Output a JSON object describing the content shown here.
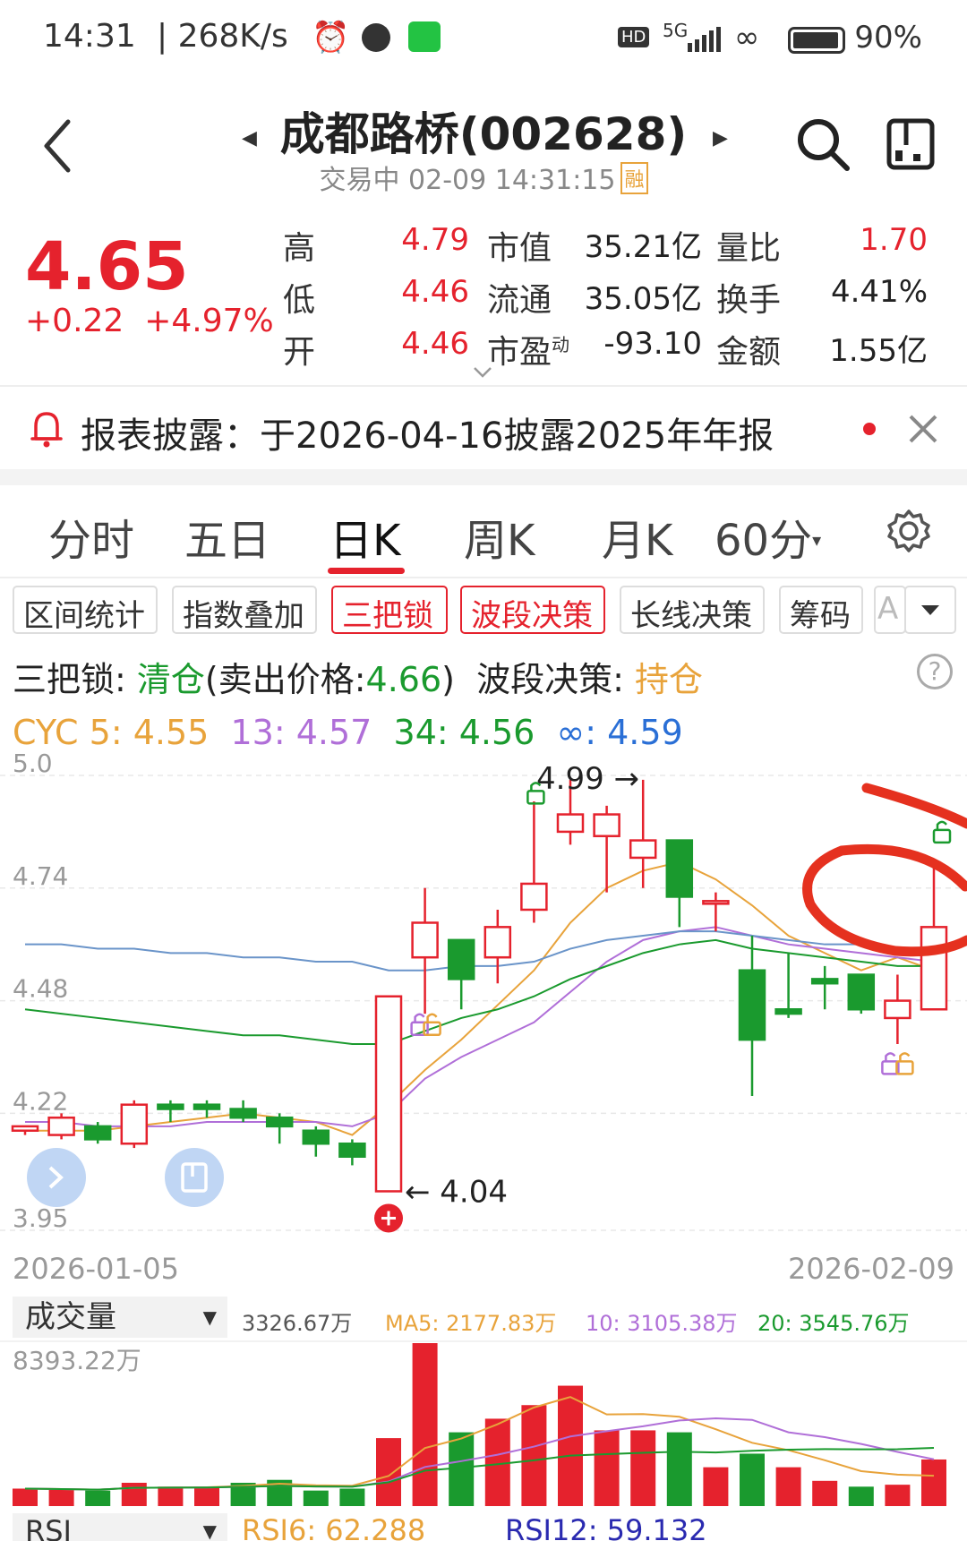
{
  "status": {
    "time": "14:31",
    "speed": "268K/s",
    "network": "5G",
    "battery": "90%"
  },
  "header": {
    "title": "成都路桥(002628)",
    "trade_status": "交易中 02-09 14:31:15",
    "rong_badge": "融"
  },
  "quote": {
    "price": "4.65",
    "change": "+0.22",
    "change_pct": "+4.97%",
    "rows": [
      {
        "label1": "高",
        "val1": "4.79",
        "label2": "市值",
        "val2": "35.21亿",
        "label3": "量比",
        "val3": "1.70"
      },
      {
        "label1": "低",
        "val1": "4.46",
        "label2": "流通",
        "val2": "35.05亿",
        "label3": "换手",
        "val3": "4.41%"
      },
      {
        "label1": "开",
        "val1": "4.46",
        "label2": "市盈",
        "label2_sup": "动",
        "val2": "-93.10",
        "label3": "金额",
        "val3": "1.55亿"
      }
    ]
  },
  "notice": {
    "text": "报表披露：于2026-04-16披露2025年年报"
  },
  "tabs": [
    "分时",
    "五日",
    "日K",
    "周K",
    "月K",
    "60分"
  ],
  "active_tab": "日K",
  "chips": [
    "区间统计",
    "指数叠加",
    "三把锁",
    "波段决策",
    "长线决策",
    "筹码",
    "A"
  ],
  "signal": {
    "label1": "三把锁: ",
    "value1": "清仓",
    "paren": "(卖出价格:",
    "price": "4.66",
    "paren_close": ")",
    "label2": "波段决策: ",
    "value2": "持仓"
  },
  "cyc": {
    "label": "CYC",
    "items": [
      {
        "text": "5: 4.55",
        "color": "#e8a33b"
      },
      {
        "text": "13: 4.57",
        "color": "#b06fd8"
      },
      {
        "text": "34: 4.56",
        "color": "#1a9a2e"
      },
      {
        "text": "∞: 4.59",
        "color": "#2a6fd6"
      }
    ]
  },
  "chart_data": {
    "type": "candlestick",
    "y_ticks": [
      "5.0",
      "4.74",
      "4.48",
      "4.22",
      "3.95"
    ],
    "ylim": [
      3.95,
      5.0
    ],
    "max_label": "4.99",
    "min_label": "4.04",
    "x_start": "2026-01-05",
    "x_end": "2026-02-09",
    "candles": [
      {
        "o": 4.18,
        "c": 4.19,
        "h": 4.19,
        "l": 4.17
      },
      {
        "o": 4.17,
        "c": 4.21,
        "h": 4.22,
        "l": 4.16
      },
      {
        "o": 4.19,
        "c": 4.16,
        "h": 4.2,
        "l": 4.15
      },
      {
        "o": 4.15,
        "c": 4.24,
        "h": 4.25,
        "l": 4.14
      },
      {
        "o": 4.24,
        "c": 4.23,
        "h": 4.25,
        "l": 4.2
      },
      {
        "o": 4.24,
        "c": 4.23,
        "h": 4.25,
        "l": 4.21
      },
      {
        "o": 4.23,
        "c": 4.21,
        "h": 4.25,
        "l": 4.2
      },
      {
        "o": 4.21,
        "c": 4.19,
        "h": 4.22,
        "l": 4.15
      },
      {
        "o": 4.18,
        "c": 4.15,
        "h": 4.19,
        "l": 4.12
      },
      {
        "o": 4.15,
        "c": 4.12,
        "h": 4.16,
        "l": 4.1
      },
      {
        "o": 4.04,
        "c": 4.49,
        "h": 4.49,
        "l": 4.04
      },
      {
        "o": 4.58,
        "c": 4.66,
        "h": 4.74,
        "l": 4.45
      },
      {
        "o": 4.62,
        "c": 4.53,
        "h": 4.62,
        "l": 4.46
      },
      {
        "o": 4.58,
        "c": 4.65,
        "h": 4.69,
        "l": 4.52
      },
      {
        "o": 4.69,
        "c": 4.75,
        "h": 4.94,
        "l": 4.66
      },
      {
        "o": 4.87,
        "c": 4.91,
        "h": 4.99,
        "l": 4.84
      },
      {
        "o": 4.86,
        "c": 4.91,
        "h": 4.93,
        "l": 4.73
      },
      {
        "o": 4.81,
        "c": 4.85,
        "h": 4.99,
        "l": 4.74
      },
      {
        "o": 4.85,
        "c": 4.72,
        "h": 4.85,
        "l": 4.65
      },
      {
        "o": 4.71,
        "c": 4.71,
        "h": 4.73,
        "l": 4.64
      },
      {
        "o": 4.55,
        "c": 4.39,
        "h": 4.63,
        "l": 4.26
      },
      {
        "o": 4.46,
        "c": 4.45,
        "h": 4.59,
        "l": 4.44
      },
      {
        "o": 4.53,
        "c": 4.52,
        "h": 4.56,
        "l": 4.46
      },
      {
        "o": 4.54,
        "c": 4.46,
        "h": 4.54,
        "l": 4.45
      },
      {
        "o": 4.44,
        "c": 4.48,
        "h": 4.54,
        "l": 4.38
      },
      {
        "o": 4.46,
        "c": 4.65,
        "h": 4.79,
        "l": 4.46
      }
    ],
    "ma_series": [
      {
        "name": "5",
        "color": "#e8a33b",
        "values": [
          4.18,
          4.18,
          4.18,
          4.19,
          4.2,
          4.21,
          4.22,
          4.21,
          4.2,
          4.17,
          4.24,
          4.32,
          4.39,
          4.47,
          4.55,
          4.66,
          4.74,
          4.78,
          4.8,
          4.76,
          4.7,
          4.63,
          4.59,
          4.55,
          4.58,
          4.55
        ]
      },
      {
        "name": "13",
        "color": "#b06fd8",
        "values": [
          4.2,
          4.2,
          4.19,
          4.19,
          4.19,
          4.2,
          4.2,
          4.2,
          4.2,
          4.19,
          4.22,
          4.3,
          4.35,
          4.39,
          4.43,
          4.5,
          4.57,
          4.62,
          4.64,
          4.65,
          4.63,
          4.61,
          4.6,
          4.59,
          4.58,
          4.57
        ]
      },
      {
        "name": "34",
        "color": "#1a9a2e",
        "values": [
          4.46,
          4.45,
          4.44,
          4.43,
          4.42,
          4.41,
          4.4,
          4.4,
          4.39,
          4.38,
          4.38,
          4.41,
          4.44,
          4.46,
          4.49,
          4.53,
          4.56,
          4.59,
          4.61,
          4.62,
          4.6,
          4.59,
          4.58,
          4.57,
          4.56,
          4.56
        ]
      },
      {
        "name": "∞",
        "color": "#6a94c9",
        "values": [
          4.61,
          4.61,
          4.6,
          4.6,
          4.59,
          4.59,
          4.58,
          4.58,
          4.57,
          4.57,
          4.55,
          4.55,
          4.56,
          4.56,
          4.57,
          4.6,
          4.62,
          4.63,
          4.64,
          4.64,
          4.63,
          4.62,
          4.61,
          4.61,
          4.6,
          4.59
        ]
      }
    ]
  },
  "volume": {
    "select_label": "成交量",
    "current": "3326.67万",
    "ma5": "MA5: 2177.83万",
    "ma10": "10: 3105.38万",
    "ma20": "20: 3545.76万",
    "max_label": "8393.22万",
    "max": 8393.22,
    "bars": [
      {
        "v": 900,
        "up": true
      },
      {
        "v": 850,
        "up": true
      },
      {
        "v": 800,
        "up": false
      },
      {
        "v": 1200,
        "up": true
      },
      {
        "v": 1000,
        "up": true
      },
      {
        "v": 1000,
        "up": true
      },
      {
        "v": 1200,
        "up": false
      },
      {
        "v": 1350,
        "up": false
      },
      {
        "v": 800,
        "up": false
      },
      {
        "v": 900,
        "up": false
      },
      {
        "v": 3500,
        "up": true
      },
      {
        "v": 8393,
        "up": true
      },
      {
        "v": 3800,
        "up": false
      },
      {
        "v": 4500,
        "up": true
      },
      {
        "v": 5200,
        "up": true
      },
      {
        "v": 6200,
        "up": true
      },
      {
        "v": 3900,
        "up": true
      },
      {
        "v": 3900,
        "up": true
      },
      {
        "v": 3800,
        "up": false
      },
      {
        "v": 2000,
        "up": true
      },
      {
        "v": 2700,
        "up": false
      },
      {
        "v": 2000,
        "up": true
      },
      {
        "v": 1300,
        "up": true
      },
      {
        "v": 1000,
        "up": false
      },
      {
        "v": 1100,
        "up": true
      },
      {
        "v": 2400,
        "up": true
      }
    ]
  },
  "rsi": {
    "select_label": "RSI",
    "rsi6": "RSI6: 62.288",
    "rsi12": "RSI12: 59.132"
  }
}
